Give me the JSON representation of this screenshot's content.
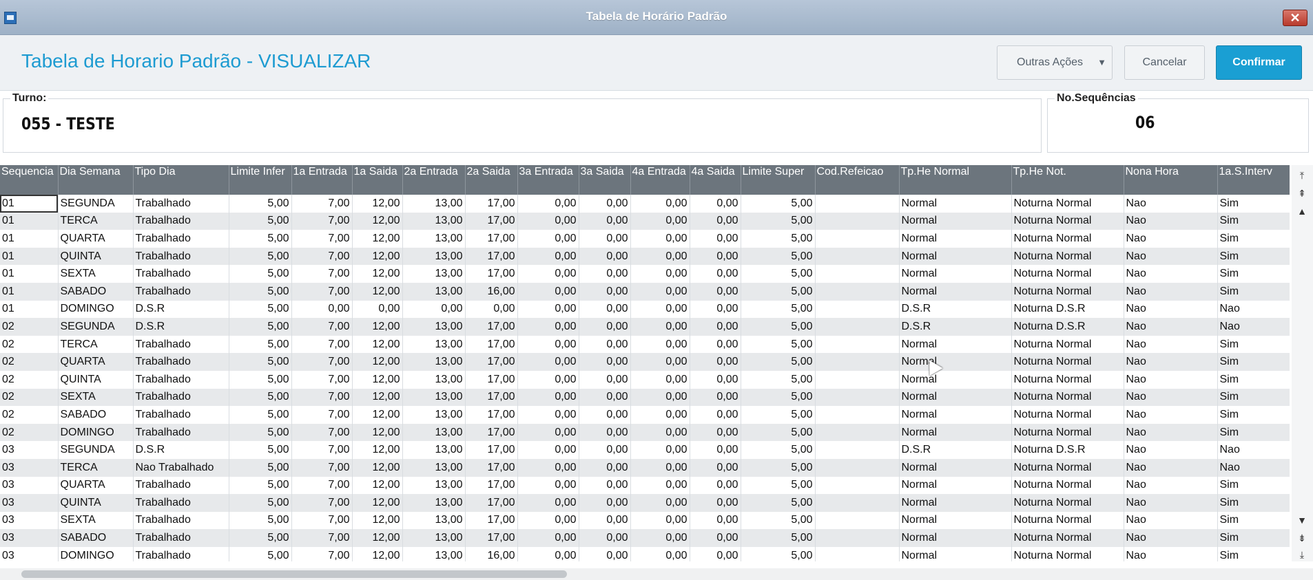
{
  "window": {
    "title": "Tabela de Horário Padrão",
    "close_icon": "close-icon"
  },
  "header": {
    "page_title": "Tabela de Horario Padrão - VISUALIZAR",
    "buttons": {
      "outras": "Outras Ações",
      "cancelar": "Cancelar",
      "confirmar": "Confirmar"
    },
    "accent_color": "#1a9fd3"
  },
  "form": {
    "turno": {
      "label": "Turno:",
      "value": "055 - TESTE"
    },
    "sequencias": {
      "label": "No.Sequências",
      "value": "06"
    }
  },
  "grid": {
    "columns": [
      "Sequencia",
      "Dia Semana",
      "Tipo Dia",
      "Limite Infer",
      "1a Entrada",
      "1a Saida",
      "2a Entrada",
      "2a Saida",
      "3a Entrada",
      "3a Saida",
      "4a Entrada",
      "4a Saida",
      "Limite Super",
      "Cod.Refeicao",
      "Tp.He Normal",
      "Tp.He Not.",
      "Nona Hora",
      "1a.S.Interv"
    ],
    "rows": [
      [
        "01",
        "SEGUNDA",
        "Trabalhado",
        "5,00",
        "7,00",
        "12,00",
        "13,00",
        "17,00",
        "0,00",
        "0,00",
        "0,00",
        "0,00",
        "5,00",
        "",
        "Normal",
        "Noturna Normal",
        "Nao",
        "Sim"
      ],
      [
        "01",
        "TERCA",
        "Trabalhado",
        "5,00",
        "7,00",
        "12,00",
        "13,00",
        "17,00",
        "0,00",
        "0,00",
        "0,00",
        "0,00",
        "5,00",
        "",
        "Normal",
        "Noturna Normal",
        "Nao",
        "Sim"
      ],
      [
        "01",
        "QUARTA",
        "Trabalhado",
        "5,00",
        "7,00",
        "12,00",
        "13,00",
        "17,00",
        "0,00",
        "0,00",
        "0,00",
        "0,00",
        "5,00",
        "",
        "Normal",
        "Noturna Normal",
        "Nao",
        "Sim"
      ],
      [
        "01",
        "QUINTA",
        "Trabalhado",
        "5,00",
        "7,00",
        "12,00",
        "13,00",
        "17,00",
        "0,00",
        "0,00",
        "0,00",
        "0,00",
        "5,00",
        "",
        "Normal",
        "Noturna Normal",
        "Nao",
        "Sim"
      ],
      [
        "01",
        "SEXTA",
        "Trabalhado",
        "5,00",
        "7,00",
        "12,00",
        "13,00",
        "17,00",
        "0,00",
        "0,00",
        "0,00",
        "0,00",
        "5,00",
        "",
        "Normal",
        "Noturna Normal",
        "Nao",
        "Sim"
      ],
      [
        "01",
        "SABADO",
        "Trabalhado",
        "5,00",
        "7,00",
        "12,00",
        "13,00",
        "16,00",
        "0,00",
        "0,00",
        "0,00",
        "0,00",
        "5,00",
        "",
        "Normal",
        "Noturna Normal",
        "Nao",
        "Sim"
      ],
      [
        "01",
        "DOMINGO",
        "D.S.R",
        "5,00",
        "0,00",
        "0,00",
        "0,00",
        "0,00",
        "0,00",
        "0,00",
        "0,00",
        "0,00",
        "5,00",
        "",
        "D.S.R",
        "Noturna D.S.R",
        "Nao",
        "Nao"
      ],
      [
        "02",
        "SEGUNDA",
        "D.S.R",
        "5,00",
        "7,00",
        "12,00",
        "13,00",
        "17,00",
        "0,00",
        "0,00",
        "0,00",
        "0,00",
        "5,00",
        "",
        "D.S.R",
        "Noturna D.S.R",
        "Nao",
        "Nao"
      ],
      [
        "02",
        "TERCA",
        "Trabalhado",
        "5,00",
        "7,00",
        "12,00",
        "13,00",
        "17,00",
        "0,00",
        "0,00",
        "0,00",
        "0,00",
        "5,00",
        "",
        "Normal",
        "Noturna Normal",
        "Nao",
        "Sim"
      ],
      [
        "02",
        "QUARTA",
        "Trabalhado",
        "5,00",
        "7,00",
        "12,00",
        "13,00",
        "17,00",
        "0,00",
        "0,00",
        "0,00",
        "0,00",
        "5,00",
        "",
        "Normal",
        "Noturna Normal",
        "Nao",
        "Sim"
      ],
      [
        "02",
        "QUINTA",
        "Trabalhado",
        "5,00",
        "7,00",
        "12,00",
        "13,00",
        "17,00",
        "0,00",
        "0,00",
        "0,00",
        "0,00",
        "5,00",
        "",
        "Normal",
        "Noturna Normal",
        "Nao",
        "Sim"
      ],
      [
        "02",
        "SEXTA",
        "Trabalhado",
        "5,00",
        "7,00",
        "12,00",
        "13,00",
        "17,00",
        "0,00",
        "0,00",
        "0,00",
        "0,00",
        "5,00",
        "",
        "Normal",
        "Noturna Normal",
        "Nao",
        "Sim"
      ],
      [
        "02",
        "SABADO",
        "Trabalhado",
        "5,00",
        "7,00",
        "12,00",
        "13,00",
        "17,00",
        "0,00",
        "0,00",
        "0,00",
        "0,00",
        "5,00",
        "",
        "Normal",
        "Noturna Normal",
        "Nao",
        "Sim"
      ],
      [
        "02",
        "DOMINGO",
        "Trabalhado",
        "5,00",
        "7,00",
        "12,00",
        "13,00",
        "17,00",
        "0,00",
        "0,00",
        "0,00",
        "0,00",
        "5,00",
        "",
        "Normal",
        "Noturna Normal",
        "Nao",
        "Sim"
      ],
      [
        "03",
        "SEGUNDA",
        "D.S.R",
        "5,00",
        "7,00",
        "12,00",
        "13,00",
        "17,00",
        "0,00",
        "0,00",
        "0,00",
        "0,00",
        "5,00",
        "",
        "D.S.R",
        "Noturna D.S.R",
        "Nao",
        "Nao"
      ],
      [
        "03",
        "TERCA",
        "Nao Trabalhado",
        "5,00",
        "7,00",
        "12,00",
        "13,00",
        "17,00",
        "0,00",
        "0,00",
        "0,00",
        "0,00",
        "5,00",
        "",
        "Normal",
        "Noturna Normal",
        "Nao",
        "Nao"
      ],
      [
        "03",
        "QUARTA",
        "Trabalhado",
        "5,00",
        "7,00",
        "12,00",
        "13,00",
        "17,00",
        "0,00",
        "0,00",
        "0,00",
        "0,00",
        "5,00",
        "",
        "Normal",
        "Noturna Normal",
        "Nao",
        "Sim"
      ],
      [
        "03",
        "QUINTA",
        "Trabalhado",
        "5,00",
        "7,00",
        "12,00",
        "13,00",
        "17,00",
        "0,00",
        "0,00",
        "0,00",
        "0,00",
        "5,00",
        "",
        "Normal",
        "Noturna Normal",
        "Nao",
        "Sim"
      ],
      [
        "03",
        "SEXTA",
        "Trabalhado",
        "5,00",
        "7,00",
        "12,00",
        "13,00",
        "17,00",
        "0,00",
        "0,00",
        "0,00",
        "0,00",
        "5,00",
        "",
        "Normal",
        "Noturna Normal",
        "Nao",
        "Sim"
      ],
      [
        "03",
        "SABADO",
        "Trabalhado",
        "5,00",
        "7,00",
        "12,00",
        "13,00",
        "17,00",
        "0,00",
        "0,00",
        "0,00",
        "0,00",
        "5,00",
        "",
        "Normal",
        "Noturna Normal",
        "Nao",
        "Sim"
      ],
      [
        "03",
        "DOMINGO",
        "Trabalhado",
        "5,00",
        "7,00",
        "12,00",
        "13,00",
        "16,00",
        "0,00",
        "0,00",
        "0,00",
        "0,00",
        "5,00",
        "",
        "Normal",
        "Noturna Normal",
        "Nao",
        "Sim"
      ]
    ]
  },
  "scroll_icons": [
    "scroll-top-icon",
    "scroll-page-up-icon",
    "scroll-up-icon",
    "scroll-down-icon",
    "scroll-page-down-icon",
    "scroll-bottom-icon"
  ]
}
